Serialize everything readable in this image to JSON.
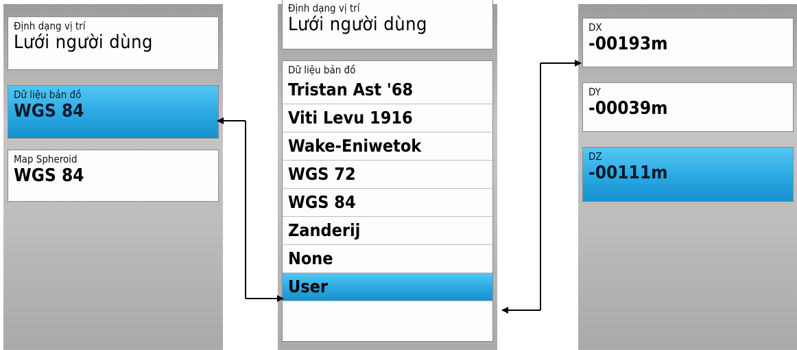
{
  "left_screen": {
    "position_format": {
      "label": "Định dạng vị trí",
      "value": "Lưới người dùng"
    },
    "map_datum": {
      "label": "Dữ liệu bản đồ",
      "value": "WGS 84"
    },
    "map_spheroid": {
      "label": "Map Spheroid",
      "value": "WGS 84"
    }
  },
  "middle_screen": {
    "position_format": {
      "label": "Định dạng vị trí",
      "value": "Lưới người dùng"
    },
    "datum_list": {
      "label": "Dữ liệu bản đồ",
      "items": [
        "Tristan Ast '68",
        "Viti Levu 1916",
        "Wake-Eniwetok",
        "WGS 72",
        "WGS 84",
        "Zanderij",
        "None",
        "User"
      ],
      "selected": "User"
    }
  },
  "right_screen": {
    "dx": {
      "label": "DX",
      "value": "-00193m"
    },
    "dy": {
      "label": "DY",
      "value": "-00039m"
    },
    "dz": {
      "label": "DZ",
      "value": "-00111m"
    }
  },
  "colors": {
    "highlight": "#2aa8e2",
    "card_bg": "#fdfdfd",
    "bezel": "#bcbcbc",
    "arrow": "#000000"
  }
}
